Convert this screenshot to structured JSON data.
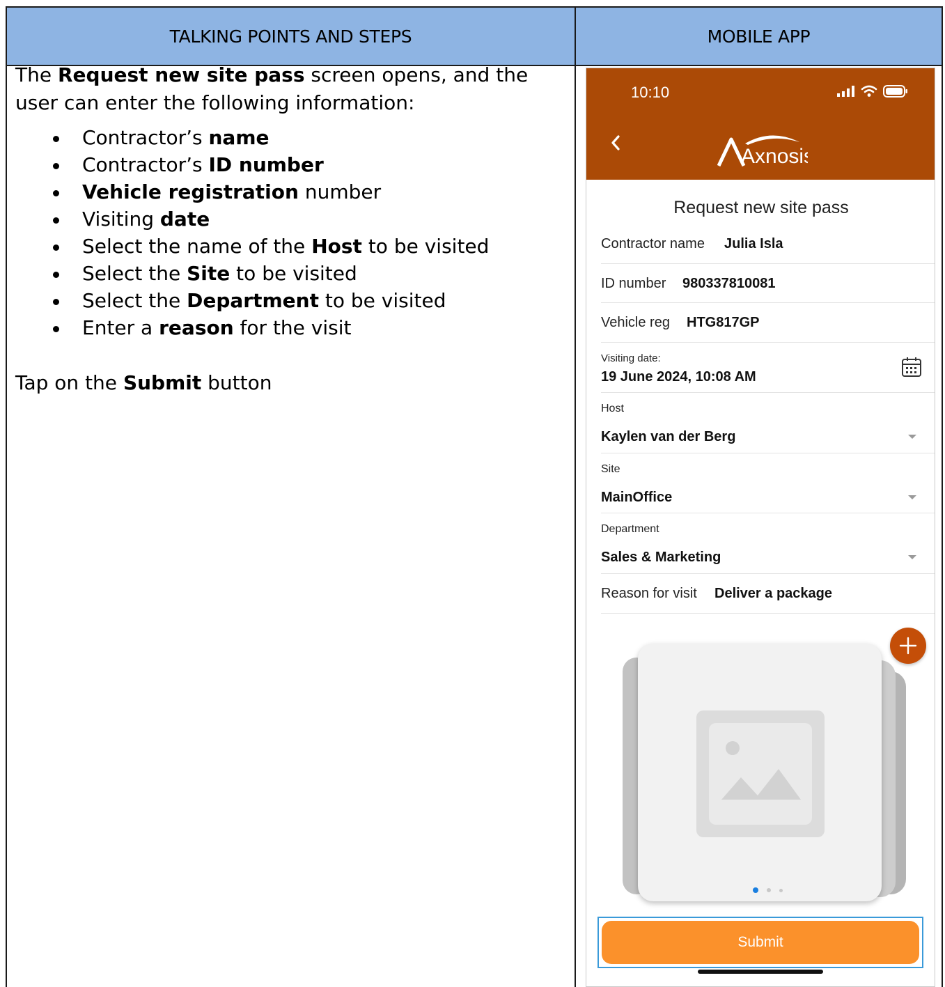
{
  "table": {
    "header_left": "TALKING POINTS AND STEPS",
    "header_right": "MOBILE APP"
  },
  "talking_points": {
    "intro_pre": "The ",
    "intro_bold": "Request new site pass",
    "intro_post": " screen opens, and the user can enter the following information:",
    "steps": [
      {
        "pre": "Contractor’s ",
        "bold": "name",
        "post": ""
      },
      {
        "pre": "Contractor’s ",
        "bold": "ID number",
        "post": ""
      },
      {
        "pre": "",
        "bold": "Vehicle registration",
        "post": " number"
      },
      {
        "pre": "Visiting ",
        "bold": "date",
        "post": ""
      },
      {
        "pre": "Select the name of the ",
        "bold": "Host",
        "post": " to be visited"
      },
      {
        "pre": "Select the ",
        "bold": "Site",
        "post": " to be visited"
      },
      {
        "pre": "Select the ",
        "bold": "Department",
        "post": " to be visited"
      },
      {
        "pre": "Enter a ",
        "bold": "reason",
        "post": " for the visit"
      }
    ],
    "outro_pre": "Tap on the ",
    "outro_bold": "Submit",
    "outro_post": " button"
  },
  "phone": {
    "status_time": "10:10",
    "logo_text": "Axnosis",
    "form_title": "Request new site pass",
    "contractor_label": "Contractor name",
    "contractor_value": "Julia Isla",
    "id_label": "ID number",
    "id_value": "980337810081",
    "vehicle_label": "Vehicle reg",
    "vehicle_value": "HTG817GP",
    "date_label": "Visiting date:",
    "date_value": "19 June 2024, 10:08 AM",
    "host_label": "Host",
    "host_value": "Kaylen van der Berg",
    "site_label": "Site",
    "site_value": "MainOffice",
    "dept_label": "Department",
    "dept_value": "Sales & Marketing",
    "reason_label": "Reason for visit",
    "reason_value": "Deliver a package",
    "submit_label": "Submit",
    "colors": {
      "header_bg": "#ab4a06",
      "submit_bg": "#fb912b",
      "add_button": "#c44e08",
      "active_dot": "#1a7fe0",
      "table_header": "#8eb4e3"
    }
  }
}
